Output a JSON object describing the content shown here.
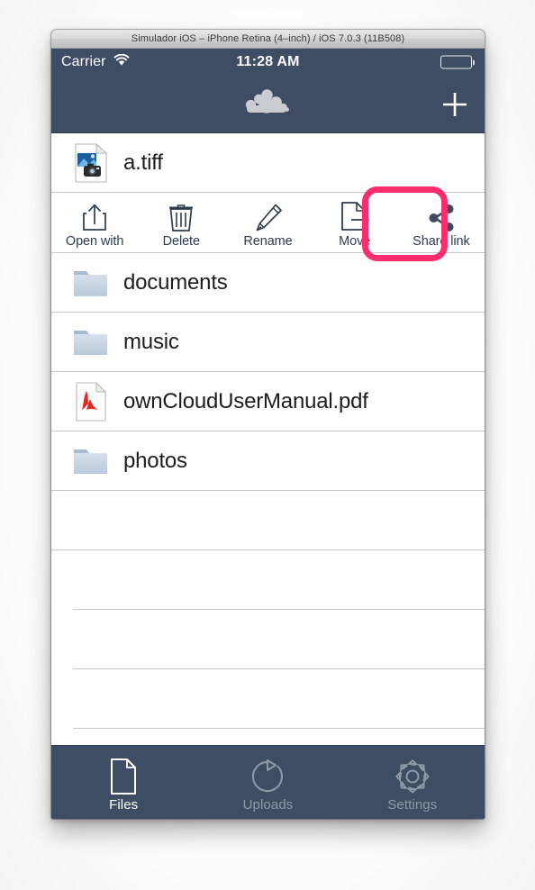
{
  "window": {
    "title": "Simulador iOS – iPhone Retina (4–inch) / iOS 7.0.3 (11B508)"
  },
  "status_bar": {
    "carrier": "Carrier",
    "wifi_icon": "wifi-icon",
    "time": "11:28 AM",
    "battery_icon": "battery-full-icon"
  },
  "nav_bar": {
    "logo_icon": "owncloud-cloud-logo",
    "add_label": "+",
    "add_icon": "plus-icon",
    "background": "#3f4d64"
  },
  "selected_file": {
    "name": "a.tiff",
    "icon": "image-file-icon"
  },
  "action_bar": {
    "actions": [
      {
        "label": "Open with",
        "icon": "open-with-icon"
      },
      {
        "label": "Delete",
        "icon": "trash-icon"
      },
      {
        "label": "Rename",
        "icon": "pencil-icon"
      },
      {
        "label": "Move",
        "icon": "move-file-icon",
        "highlighted": true
      },
      {
        "label": "Share link",
        "icon": "share-icon"
      }
    ],
    "highlight_color": "#fa2e6d"
  },
  "file_list": {
    "items": [
      {
        "name": "documents",
        "icon": "folder-icon",
        "type": "folder"
      },
      {
        "name": "music",
        "icon": "folder-icon",
        "type": "folder"
      },
      {
        "name": "ownCloudUserManual.pdf",
        "icon": "pdf-file-icon",
        "type": "file"
      },
      {
        "name": "photos",
        "icon": "folder-icon",
        "type": "folder"
      }
    ],
    "empty_rows": 4
  },
  "tab_bar": {
    "tabs": [
      {
        "label": "Files",
        "icon": "document-icon",
        "active": true
      },
      {
        "label": "Uploads",
        "icon": "upload-refresh-icon",
        "active": false
      },
      {
        "label": "Settings",
        "icon": "gear-icon",
        "active": false
      }
    ],
    "active_color": "#ffffff",
    "inactive_color": "#8f99a9"
  }
}
